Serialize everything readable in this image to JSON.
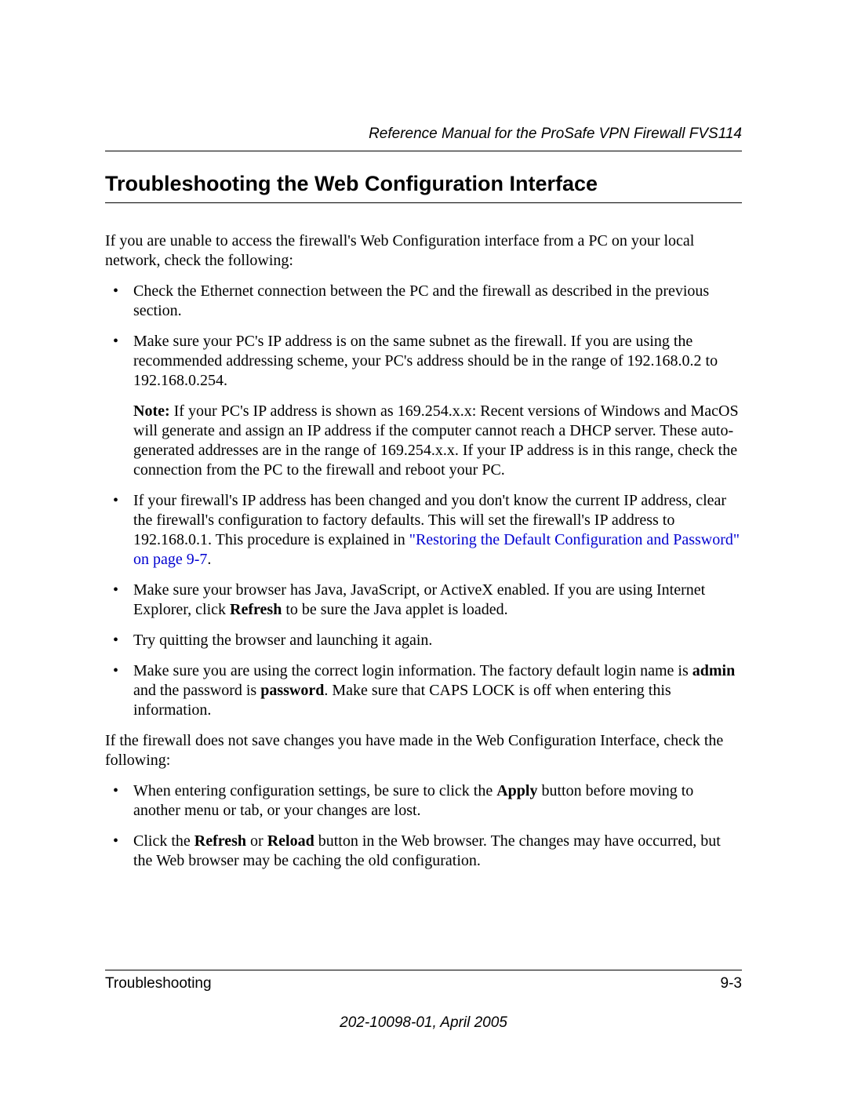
{
  "header": {
    "running_title": "Reference Manual for the ProSafe VPN Firewall FVS114"
  },
  "title": "Troubleshooting the Web Configuration Interface",
  "intro": "If you are unable to access the firewall's Web Configuration interface from a PC on your local network, check the following:",
  "bullets1": {
    "b0": "Check the Ethernet connection between the PC and the firewall as described in the previous section.",
    "b1": "Make sure your PC's IP address is on the same subnet as the firewall. If you are using the recommended addressing scheme, your PC's address should be in the range of 192.168.0.2 to 192.168.0.254.",
    "b1_note_label": "Note:",
    "b1_note": " If your PC's IP address is shown as 169.254.x.x: Recent versions of Windows and MacOS will generate and assign an IP address if the computer cannot reach a DHCP server. These auto-generated addresses are in the range of 169.254.x.x. If your IP address is in this range, check the connection from the PC to the firewall and reboot your PC.",
    "b2_a": "If your firewall's IP address has been changed and you don't know the current IP address, clear the firewall's configuration to factory defaults. This will set the firewall's IP address to 192.168.0.1. This procedure is explained in ",
    "b2_link": "\"Restoring the Default Configuration and Password\" on page 9-7",
    "b2_b": ".",
    "b3_a": "Make sure your browser has Java, JavaScript, or ActiveX enabled. If you are using Internet Explorer, click ",
    "b3_bold": "Refresh",
    "b3_b": " to be sure the Java applet is loaded.",
    "b4": "Try quitting the browser and launching it again.",
    "b5_a": "Make sure you are using the correct login information. The factory default login name is ",
    "b5_bold1": "admin",
    "b5_b": " and the password is ",
    "b5_bold2": "password",
    "b5_c": ". Make sure that CAPS LOCK is off when entering this information."
  },
  "mid": "If the firewall does not save changes you have made in the Web Configuration Interface, check the following:",
  "bullets2": {
    "b0_a": "When entering configuration settings, be sure to click the ",
    "b0_bold": "Apply",
    "b0_b": " button before moving to another menu or tab, or your changes are lost.",
    "b1_a": "Click the ",
    "b1_bold1": "Refresh",
    "b1_b": " or ",
    "b1_bold2": "Reload",
    "b1_c": " button in the Web browser. The changes may have occurred, but the Web browser may be caching the old configuration."
  },
  "footer": {
    "section": "Troubleshooting",
    "page": "9-3",
    "docinfo": "202-10098-01, April 2005"
  }
}
